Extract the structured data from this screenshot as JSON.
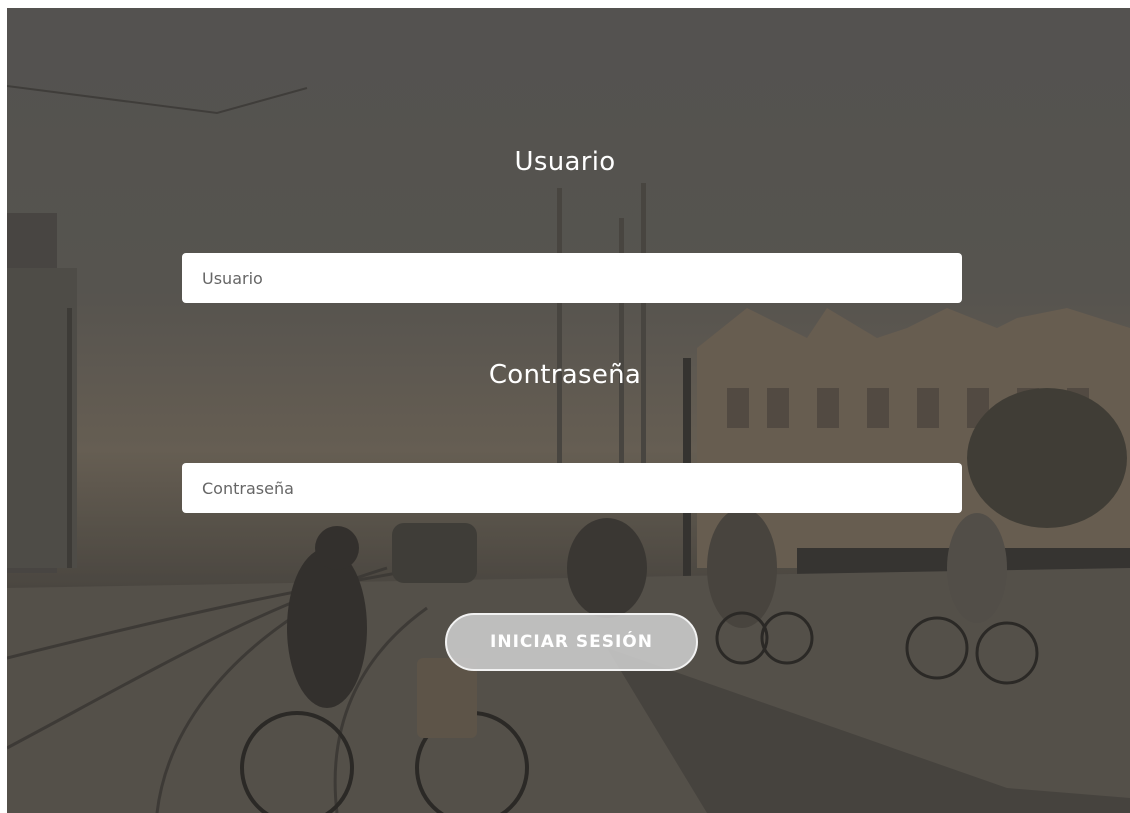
{
  "form": {
    "username_label": "Usuario",
    "username_placeholder": "Usuario",
    "password_label": "Contraseña",
    "password_placeholder": "Contraseña",
    "submit_label": "INICIAR SESIÓN"
  },
  "colors": {
    "overlay": "#5e5a55",
    "input_background": "#ffffff",
    "button_background": "#cdcdcd",
    "label_text": "#ffffff"
  }
}
